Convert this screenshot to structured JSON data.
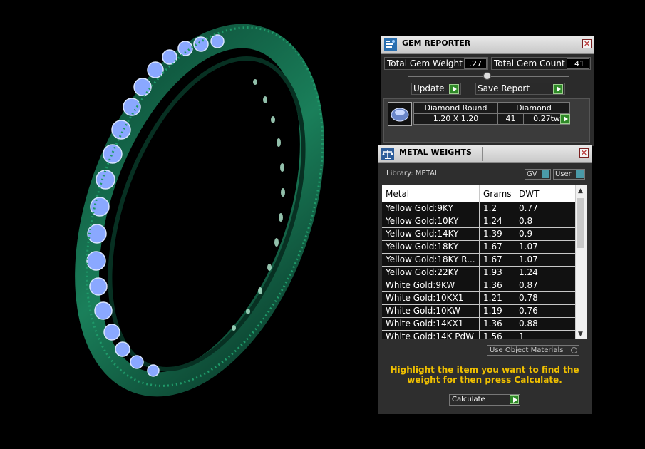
{
  "gem_reporter": {
    "title": "GEM REPORTER",
    "total_weight_label": "Total Gem Weight",
    "total_weight_value": ".27",
    "total_count_label": "Total Gem Count",
    "total_count_value": "41",
    "update_label": "Update",
    "save_report_label": "Save Report",
    "gem": {
      "shape": "Diamond Round",
      "size": "1.20 X 1.20",
      "material": "Diamond",
      "count": "41",
      "weight": "0.27tw"
    }
  },
  "metal_weights": {
    "title": "METAL WEIGHTS",
    "library_label": "Library: METAL",
    "gv_label": "GV",
    "user_label": "User",
    "columns": [
      "Metal",
      "Grams",
      "DWT"
    ],
    "rows": [
      [
        "Yellow Gold:9KY",
        "1.2",
        "0.77"
      ],
      [
        "Yellow Gold:10KY",
        "1.24",
        "0.8"
      ],
      [
        "Yellow Gold:14KY",
        "1.39",
        "0.9"
      ],
      [
        "Yellow Gold:18KY",
        "1.67",
        "1.07"
      ],
      [
        "Yellow Gold:18KY R...",
        "1.67",
        "1.07"
      ],
      [
        "Yellow Gold:22KY",
        "1.93",
        "1.24"
      ],
      [
        "White Gold:9KW",
        "1.36",
        "0.87"
      ],
      [
        "White Gold:10KX1",
        "1.21",
        "0.78"
      ],
      [
        "White Gold:10KW",
        "1.19",
        "0.76"
      ],
      [
        "White Gold:14KX1",
        "1.36",
        "0.88"
      ],
      [
        "White Gold:14K PdW",
        "1.56",
        "1"
      ]
    ],
    "use_object_materials_label": "Use Object Materials",
    "hint": "Highlight the item you want to find the weight for then press Calculate.",
    "calculate_label": "Calculate"
  },
  "colors": {
    "ring": "#0f6a4a",
    "gem": "#8aa8ff",
    "hint": "#f0c000",
    "accent_button": "#2f8a28"
  }
}
